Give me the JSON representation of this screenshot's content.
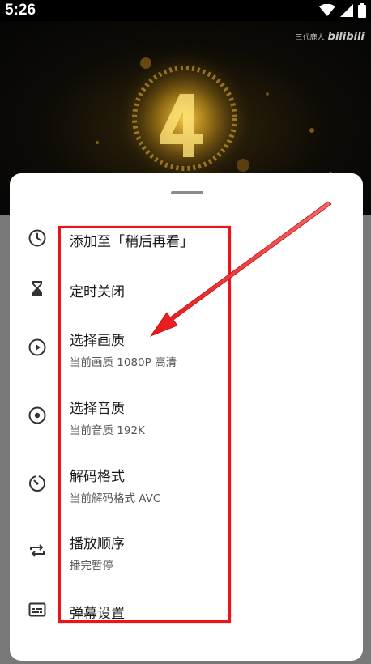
{
  "status_bar": {
    "time": "5:26"
  },
  "video": {
    "watermark_text": "三代鹿人",
    "watermark_logo": "bilibili"
  },
  "menu": {
    "items": [
      {
        "icon": "clock-icon",
        "title": "添加至「稍后再看」",
        "subtitle": ""
      },
      {
        "icon": "hourglass-icon",
        "title": "定时关闭",
        "subtitle": ""
      },
      {
        "icon": "play-circle-icon",
        "title": "选择画质",
        "subtitle": "当前画质 1080P 高清"
      },
      {
        "icon": "disc-icon",
        "title": "选择音质",
        "subtitle": "当前音质 192K"
      },
      {
        "icon": "timer-icon",
        "title": "解码格式",
        "subtitle": "当前解码格式 AVC"
      },
      {
        "icon": "repeat-icon",
        "title": "播放顺序",
        "subtitle": "播完暂停"
      },
      {
        "icon": "subtitles-icon",
        "title": "弹幕设置",
        "subtitle": ""
      }
    ]
  },
  "colors": {
    "annotation": "#e8161b",
    "sheet_background": "#ffffff",
    "overlay": "#787878"
  }
}
